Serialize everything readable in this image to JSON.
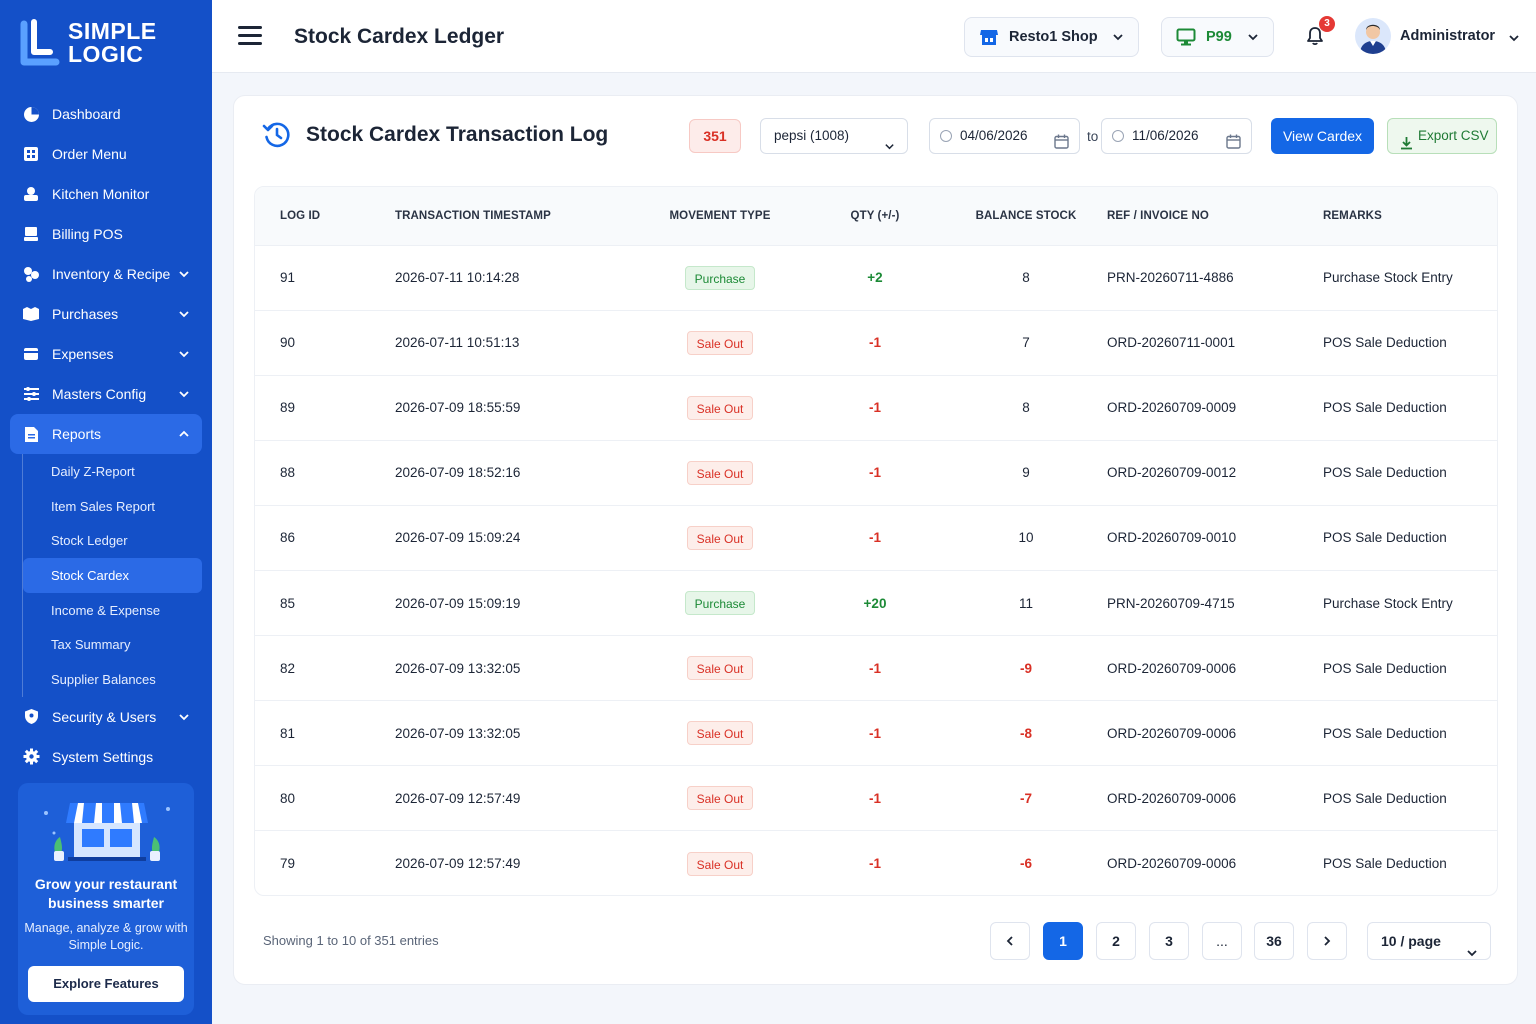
{
  "brand": {
    "line1": "SIMPLE",
    "line2": "LOGIC"
  },
  "sidebar": {
    "items": [
      {
        "label": "Dashboard",
        "icon": "dashboard-icon"
      },
      {
        "label": "Order Menu",
        "icon": "order-menu-icon"
      },
      {
        "label": "Kitchen Monitor",
        "icon": "kitchen-icon"
      },
      {
        "label": "Billing POS",
        "icon": "billing-icon"
      },
      {
        "label": "Inventory & Recipe",
        "icon": "inventory-icon",
        "expandable": true
      },
      {
        "label": "Purchases",
        "icon": "purchases-icon",
        "expandable": true
      },
      {
        "label": "Expenses",
        "icon": "expenses-icon",
        "expandable": true
      },
      {
        "label": "Masters Config",
        "icon": "masters-icon",
        "expandable": true
      },
      {
        "label": "Reports",
        "icon": "reports-icon",
        "expandable": true,
        "expanded": true,
        "active": true
      }
    ],
    "reports_sub": [
      {
        "label": "Daily Z-Report"
      },
      {
        "label": "Item Sales Report"
      },
      {
        "label": "Stock Ledger"
      },
      {
        "label": "Stock Cardex",
        "active": true
      },
      {
        "label": "Income & Expense"
      },
      {
        "label": "Tax Summary"
      },
      {
        "label": "Supplier Balances"
      }
    ],
    "bottom_items": [
      {
        "label": "Security & Users",
        "icon": "shield-icon",
        "expandable": true
      },
      {
        "label": "System Settings",
        "icon": "gear-icon"
      }
    ],
    "promo": {
      "title": "Grow your restaurant business smarter",
      "subtitle": "Manage, analyze & grow with Simple Logic.",
      "button": "Explore Features"
    }
  },
  "topbar": {
    "title": "Stock Cardex Ledger",
    "shop": "Resto1 Shop",
    "terminal": "P99",
    "notifications": "3",
    "user": "Administrator"
  },
  "card": {
    "title": "Stock Cardex Transaction Log",
    "count": "351",
    "item_select": "pepsi (1008)",
    "date_from": "04/06/2026",
    "date_sep": "to",
    "date_to": "11/06/2026",
    "view_button": "View Cardex",
    "export_button": "Export CSV"
  },
  "table": {
    "headers": [
      "LOG ID",
      "TRANSACTION TIMESTAMP",
      "MOVEMENT TYPE",
      "QTY (+/-)",
      "BALANCE STOCK",
      "REF / INVOICE NO",
      "REMARKS"
    ],
    "rows": [
      {
        "id": "91",
        "ts": "2026-07-11 10:14:28",
        "type": "Purchase",
        "qty": "+2",
        "bal": "8",
        "ref": "PRN-20260711-4886",
        "remarks": "Purchase Stock Entry"
      },
      {
        "id": "90",
        "ts": "2026-07-11 10:51:13",
        "type": "Sale Out",
        "qty": "-1",
        "bal": "7",
        "ref": "ORD-20260711-0001",
        "remarks": "POS Sale Deduction"
      },
      {
        "id": "89",
        "ts": "2026-07-09 18:55:59",
        "type": "Sale Out",
        "qty": "-1",
        "bal": "8",
        "ref": "ORD-20260709-0009",
        "remarks": "POS Sale Deduction"
      },
      {
        "id": "88",
        "ts": "2026-07-09 18:52:16",
        "type": "Sale Out",
        "qty": "-1",
        "bal": "9",
        "ref": "ORD-20260709-0012",
        "remarks": "POS Sale Deduction"
      },
      {
        "id": "86",
        "ts": "2026-07-09 15:09:24",
        "type": "Sale Out",
        "qty": "-1",
        "bal": "10",
        "ref": "ORD-20260709-0010",
        "remarks": "POS Sale Deduction"
      },
      {
        "id": "85",
        "ts": "2026-07-09 15:09:19",
        "type": "Purchase",
        "qty": "+20",
        "bal": "11",
        "ref": "PRN-20260709-4715",
        "remarks": "Purchase Stock Entry"
      },
      {
        "id": "82",
        "ts": "2026-07-09 13:32:05",
        "type": "Sale Out",
        "qty": "-1",
        "bal": "-9",
        "ref": "ORD-20260709-0006",
        "remarks": "POS Sale Deduction"
      },
      {
        "id": "81",
        "ts": "2026-07-09 13:32:05",
        "type": "Sale Out",
        "qty": "-1",
        "bal": "-8",
        "ref": "ORD-20260709-0006",
        "remarks": "POS Sale Deduction"
      },
      {
        "id": "80",
        "ts": "2026-07-09 12:57:49",
        "type": "Sale Out",
        "qty": "-1",
        "bal": "-7",
        "ref": "ORD-20260709-0006",
        "remarks": "POS Sale Deduction"
      },
      {
        "id": "79",
        "ts": "2026-07-09 12:57:49",
        "type": "Sale Out",
        "qty": "-1",
        "bal": "-6",
        "ref": "ORD-20260709-0006",
        "remarks": "POS Sale Deduction"
      }
    ]
  },
  "footer": {
    "showing": "Showing 1 to 10 of 351 entries",
    "pages": [
      "1",
      "2",
      "3",
      "...",
      "36"
    ],
    "current_page": "1",
    "per_page": "10 / page"
  },
  "colors": {
    "sidebar": "#1450c8",
    "accent": "#1467e6",
    "positive": "#1c8a36",
    "negative": "#d93025"
  }
}
